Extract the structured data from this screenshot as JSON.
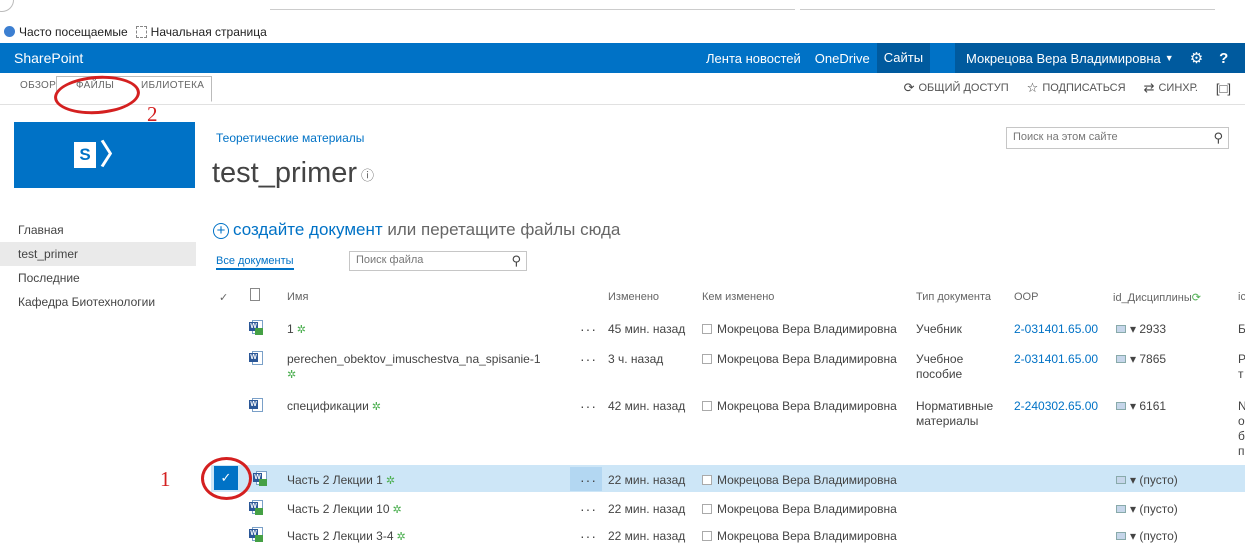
{
  "bookmarks": {
    "frequent": "Часто посещаемые",
    "home": "Начальная страница"
  },
  "suitebar": {
    "brand": "SharePoint",
    "links": [
      "Лента новостей",
      "OneDrive",
      "Сайты"
    ],
    "user": "Мокрецова Вера Владимировна"
  },
  "ribbon": {
    "tabs": [
      "ОБЗОР",
      "ФАЙЛЫ",
      "БИБЛИОТЕКА"
    ],
    "tab_library_visible": "ИБЛИОТЕКА",
    "share": "ОБЩИЙ ДОСТУП",
    "follow": "ПОДПИСАТЬСЯ",
    "sync": "СИНХР."
  },
  "site": {
    "breadcrumb": "Теоретические материалы",
    "title": "test_primer",
    "search_placeholder": "Поиск на этом сайте"
  },
  "leftnav": [
    "Главная",
    "test_primer",
    "Последние",
    "Кафедра Биотехнологии"
  ],
  "library": {
    "new_doc_link": "создайте документ",
    "new_doc_rest": " или перетащите файлы сюда",
    "view": "Все документы",
    "file_search_placeholder": "Поиск файла",
    "columns": [
      "Имя",
      "Изменено",
      "Кем изменено",
      "Тип документа",
      "ООР",
      "id_Дисциплины",
      "ic"
    ],
    "rows": [
      {
        "name": "1",
        "modified": "45 мин. назад",
        "by": "Мокрецова Вера Владимировна",
        "type": "Учебник",
        "oop": "2-031401.65.00",
        "id": "2933",
        "extra": "Б"
      },
      {
        "name": "perechen_obektov_imuschestva_na_spisanie-1",
        "modified": "3 ч. назад",
        "by": "Мокрецова Вера Владимировна",
        "type": "Учебное пособие",
        "oop": "2-031401.65.00",
        "id": "7865",
        "extra": "Р т"
      },
      {
        "name": "спецификации",
        "modified": "42 мин. назад",
        "by": "Мокрецова Вера Владимировна",
        "type": "Нормативные материалы",
        "oop": "2-240302.65.00",
        "id": "6161",
        "extra": "N о б п"
      },
      {
        "name": "Часть 2 Лекции 1",
        "modified": "22 мин. назад",
        "by": "Мокрецова Вера Владимировна",
        "type": "",
        "oop": "",
        "id": "(пусто)",
        "extra": ""
      },
      {
        "name": "Часть 2 Лекции 10",
        "modified": "22 мин. назад",
        "by": "Мокрецова Вера Владимировна",
        "type": "",
        "oop": "",
        "id": "(пусто)",
        "extra": ""
      },
      {
        "name": "Часть 2 Лекции 3-4",
        "modified": "22 мин. назад",
        "by": "Мокрецова Вера Владимировна",
        "type": "",
        "oop": "",
        "id": "(пусто)",
        "extra": ""
      }
    ]
  },
  "annotations": {
    "num1": "1",
    "num2": "2"
  },
  "colors": {
    "accent": "#0072c6",
    "annotation": "#d42020",
    "selected_row": "#cde6f7"
  }
}
